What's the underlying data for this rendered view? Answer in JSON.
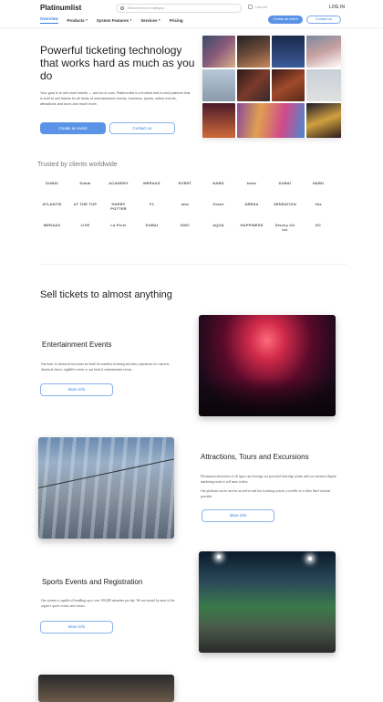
{
  "header": {
    "logo": "Platinumlist",
    "search_placeholder": "Search event of category",
    "calendar_label": "Calendar",
    "login": "LOG IN",
    "nav": [
      {
        "label": "Overview",
        "dropdown": false,
        "active": true
      },
      {
        "label": "Products",
        "dropdown": true
      },
      {
        "label": "System Features",
        "dropdown": true
      },
      {
        "label": "Services",
        "dropdown": true
      },
      {
        "label": "Pricing",
        "dropdown": false
      }
    ],
    "create_event": "Create an event",
    "contact_us": "Contact us"
  },
  "hero": {
    "title": "Powerful ticketing technology that works hard as much as you do",
    "text": "Your goal is to sell more tickets — and so is ours. Platinumlist is a trusted end-to-end platform that is built to sell tickets for all kinds of entertainment events, business, sports, online events, attractions and tours and much more.",
    "create_event": "Create an event",
    "contact_us": "Contact us"
  },
  "trusted": {
    "title": "Trusted by clients worldwide",
    "logos": [
      "DUBAI",
      "Dubai",
      "ACADEMY",
      "MERAAS",
      "EVENT",
      "NABD",
      "taste",
      "DUBAI",
      "NABD",
      "ATLANTIS",
      "AT THE TOP",
      "HARRY POTTER",
      "F1",
      "mbc",
      "Grace",
      "ARENA",
      "SENSATION",
      "Yas",
      "MERAAS",
      "LIVE",
      "La Perle",
      "DUBAI",
      "DWC",
      "AQUA",
      "HAPPINESS",
      "Disney On Ice",
      "DC"
    ]
  },
  "section": {
    "title": "Sell tickets to almost anything",
    "items": [
      {
        "title": "Entertainment Events",
        "text": "Our basic to advanced structures are built for seamless ticketing and entry operations for concerts, theatrical shows, nightlife events or any kind of entertainment events.",
        "more": "More info"
      },
      {
        "title": "Attractions, Tours and Excursions",
        "text": "Destination attractions of all types can leverage our powerful ticketing system and our extensive digital marketing reach to sell more tickets.",
        "text2": "Our platform can be used as an end-to-end box ticketing system, a reseller or a white label solution provider.",
        "more": "More info"
      },
      {
        "title": "Sports Events and Registration",
        "text": "Our system is capable of handling up to over 100,000 attendees per day. We are trusted by most of the region's sports events and venues.",
        "more": "More info"
      }
    ]
  },
  "icons": {
    "search": "search-icon",
    "calendar": "calendar-icon",
    "caret": "chevron-down-icon"
  },
  "colors": {
    "accent": "#5b93e6",
    "accent_text": "#3b82d9"
  }
}
